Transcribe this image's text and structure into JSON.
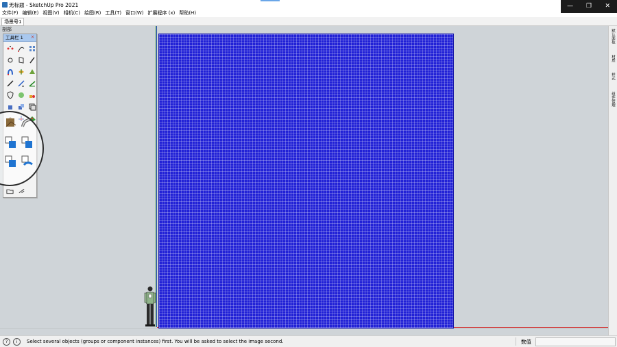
{
  "window": {
    "title": "无标题 - SketchUp Pro 2021",
    "controls": {
      "minimize": "—",
      "maximize": "❐",
      "close": "✕"
    }
  },
  "menu": {
    "items": [
      "文件(F)",
      "编辑(E)",
      "视图(V)",
      "相机(C)",
      "绘图(R)",
      "工具(T)",
      "窗口(W)",
      "扩展程序 (x)",
      "帮助(H)"
    ]
  },
  "scenes": {
    "tab": "场景号1"
  },
  "viewport": {
    "label": "剖部"
  },
  "toolbar": {
    "title": "工具栏 1",
    "close": "×",
    "tools": [
      "select-icon",
      "lasso-icon",
      "component-icon",
      "eraser-icon",
      "rectangle-icon",
      "pencil-icon",
      "magnet-icon",
      "push-pull-icon",
      "paint-icon",
      "line-tool-icon",
      "measure-icon",
      "protractor-icon",
      "shield-icon",
      "cloud-tree-icon",
      "shapes-icon",
      "cube-small-icon",
      "cube-double-icon",
      "layers-icon",
      "grid-icon",
      "axis-icon",
      "terrain-icon"
    ],
    "bottom_tools": [
      "folder-icon",
      "merge-icon"
    ]
  },
  "magnifier": {
    "tools": [
      "box-photo-icon",
      "cube-photo-icon",
      "box-photo-icon",
      "box-photo-icon"
    ]
  },
  "dock": {
    "tabs": [
      "默认面板",
      "材质",
      "样式",
      "组件管理"
    ]
  },
  "status": {
    "message": "Select several objects (groups or component instances) first. You will be asked to select the image second.",
    "value_label": "数值",
    "value": ""
  },
  "colors": {
    "image_plane": "#2121d6",
    "toolbar_head": "#a9c8ee",
    "viewport_bg": "#cfd4d8"
  }
}
